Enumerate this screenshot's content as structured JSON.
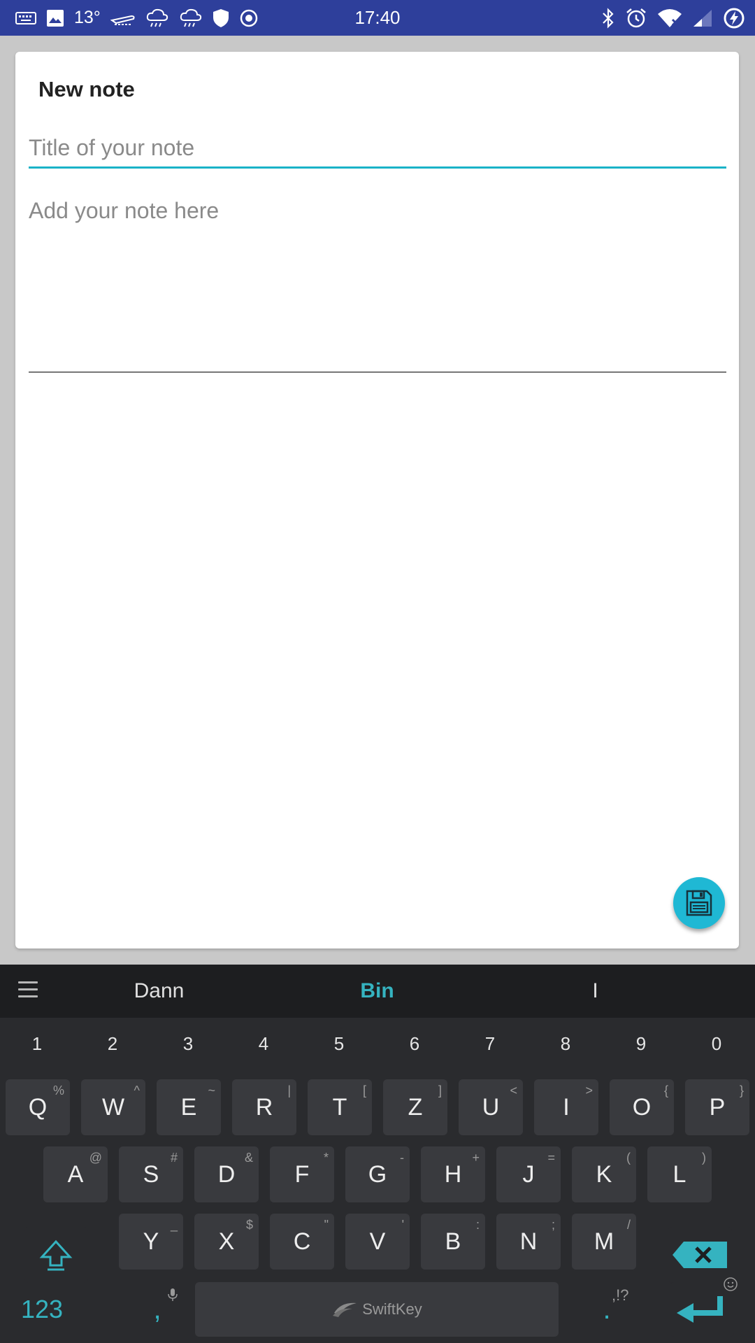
{
  "status_bar": {
    "temperature": "13°",
    "time": "17:40"
  },
  "card": {
    "title": "New note",
    "title_placeholder": "Title of your note",
    "note_placeholder": "Add your note here"
  },
  "keyboard": {
    "suggestions": [
      "Dann",
      "Bin",
      "I"
    ],
    "number_row": [
      "1",
      "2",
      "3",
      "4",
      "5",
      "6",
      "7",
      "8",
      "9",
      "0"
    ],
    "row1": [
      {
        "k": "Q",
        "a": "%"
      },
      {
        "k": "W",
        "a": "^"
      },
      {
        "k": "E",
        "a": "~"
      },
      {
        "k": "R",
        "a": "|"
      },
      {
        "k": "T",
        "a": "["
      },
      {
        "k": "Z",
        "a": "]"
      },
      {
        "k": "U",
        "a": "<"
      },
      {
        "k": "I",
        "a": ">"
      },
      {
        "k": "O",
        "a": "{"
      },
      {
        "k": "P",
        "a": "}"
      }
    ],
    "row2": [
      {
        "k": "A",
        "a": "@"
      },
      {
        "k": "S",
        "a": "#"
      },
      {
        "k": "D",
        "a": "&"
      },
      {
        "k": "F",
        "a": "*"
      },
      {
        "k": "G",
        "a": "-"
      },
      {
        "k": "H",
        "a": "+"
      },
      {
        "k": "J",
        "a": "="
      },
      {
        "k": "K",
        "a": "("
      },
      {
        "k": "L",
        "a": ")"
      }
    ],
    "row3": [
      {
        "k": "Y",
        "a": "_"
      },
      {
        "k": "X",
        "a": "$"
      },
      {
        "k": "C",
        "a": "\""
      },
      {
        "k": "V",
        "a": "'"
      },
      {
        "k": "B",
        "a": ":"
      },
      {
        "k": "N",
        "a": ";"
      },
      {
        "k": "M",
        "a": "/"
      }
    ],
    "numbers_key": "123",
    "comma_key": ",",
    "space_brand": "SwiftKey",
    "period_key": ".",
    "punct_hint": ",!?"
  },
  "colors": {
    "status_bar": "#2e3f9b",
    "accent": "#1ab3c8",
    "keyboard_accent": "#35b3c0"
  }
}
